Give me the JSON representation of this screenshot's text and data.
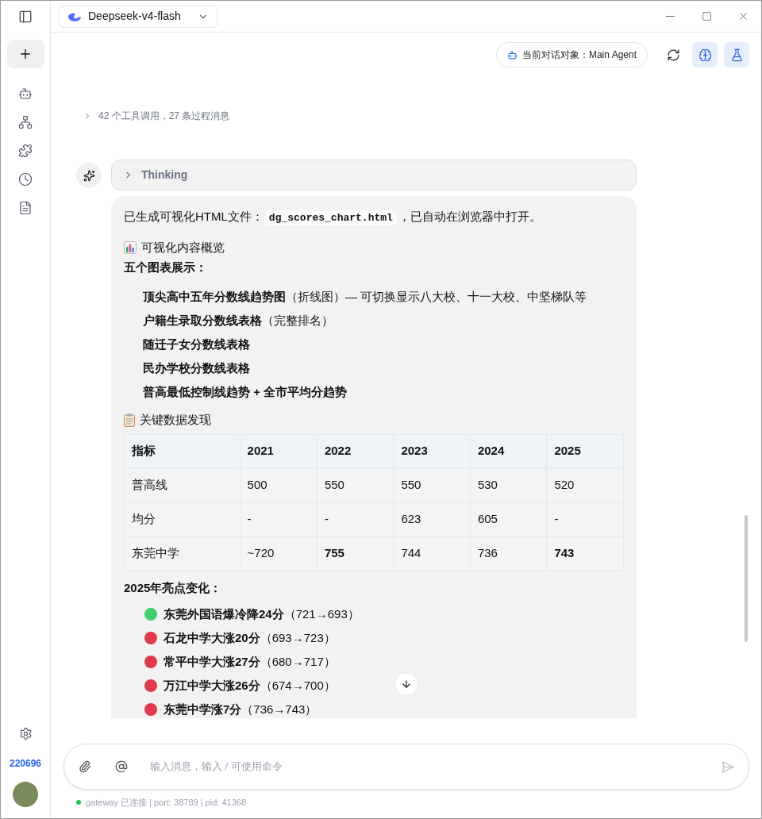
{
  "model_selector": {
    "label": "Deepseek-v4-flash"
  },
  "sidebar": {
    "items": [
      {
        "kind": "new"
      },
      {
        "kind": "bot"
      },
      {
        "kind": "tree"
      },
      {
        "kind": "puzzle"
      },
      {
        "kind": "clock"
      },
      {
        "kind": "file"
      }
    ],
    "user_id": "220696"
  },
  "toolbar": {
    "agent_label": "当前对话对象：Main Agent",
    "buttons": [
      {
        "kind": "refresh",
        "selected": false
      },
      {
        "kind": "brain",
        "selected": true
      },
      {
        "kind": "flask",
        "selected": true
      }
    ]
  },
  "process_summary": "42 个工具调用，27 条过程消息",
  "thinking": {
    "label": "Thinking",
    "expanded": false
  },
  "message": {
    "intro": {
      "before": "已生成可视化HTML文件：",
      "code": "dg_scores_chart.html",
      "after": "，已自动在浏览器中打开。"
    },
    "overview_heading": "可视化内容概览",
    "charts_heading": "五个图表展示：",
    "charts": [
      {
        "title": "顶尖高中五年分数线趋势图",
        "note": "（折线图）— 可切换显示八大校、十一大校、中坚梯队等"
      },
      {
        "title": "户籍生录取分数线表格",
        "note": "（完整排名）"
      },
      {
        "title": "随迁子女分数线表格"
      },
      {
        "title": "民办学校分数线表格"
      },
      {
        "title": "普高最低控制线趋势 + 全市平均分趋势"
      }
    ],
    "findings_heading": "关键数据发现",
    "table": {
      "columns": [
        "指标",
        "2021",
        "2022",
        "2023",
        "2024",
        "2025"
      ],
      "rows": [
        [
          {
            "text": "普高线",
            "bold": false
          },
          {
            "text": "500",
            "bold": false
          },
          {
            "text": "550",
            "bold": false
          },
          {
            "text": "550",
            "bold": false
          },
          {
            "text": "530",
            "bold": false
          },
          {
            "text": "520",
            "bold": false
          }
        ],
        [
          {
            "text": "均分",
            "bold": false
          },
          {
            "text": "-",
            "bold": false
          },
          {
            "text": "-",
            "bold": false
          },
          {
            "text": "623",
            "bold": false
          },
          {
            "text": "605",
            "bold": false
          },
          {
            "text": "-",
            "bold": false
          }
        ],
        [
          {
            "text": "东莞中学",
            "bold": false
          },
          {
            "text": "~720",
            "bold": false
          },
          {
            "text": "755",
            "bold": true
          },
          {
            "text": "744",
            "bold": false
          },
          {
            "text": "736",
            "bold": false
          },
          {
            "text": "743",
            "bold": true
          }
        ]
      ]
    },
    "highlights_heading": "2025年亮点变化：",
    "highlights": [
      {
        "title": "东莞外国语爆冷降24分",
        "note": "（721→693）",
        "color": "#3ecf6e"
      },
      {
        "title": "石龙中学大涨20分",
        "note": "（693→723）",
        "color": "#e03a4f"
      },
      {
        "title": "常平中学大涨27分",
        "note": "（680→717）",
        "color": "#e03a4f"
      },
      {
        "title": "万江中学大涨26分",
        "note": "（674→700）",
        "color": "#e03a4f"
      },
      {
        "title": "东莞中学涨7分",
        "note": "（736→743）",
        "color": "#e03a4f"
      }
    ]
  },
  "input": {
    "placeholder": "输入消息，输入 / 可使用命令"
  },
  "status_bar": {
    "connected": true,
    "text": "gateway 已连接 | port: 38789 | pid: 41368"
  }
}
